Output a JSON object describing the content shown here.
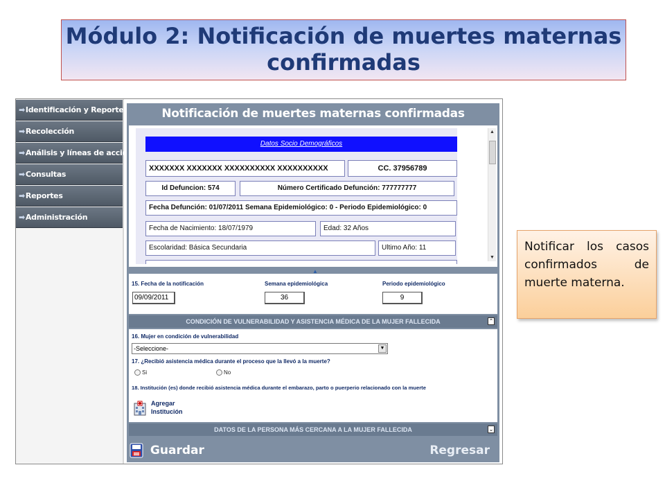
{
  "slide": {
    "title_line1": "Módulo 2: Notificación de muertes maternas",
    "title_line2": "confirmadas"
  },
  "sidebar": {
    "items": [
      {
        "label": "Identificación y Reporte"
      },
      {
        "label": "Recolección"
      },
      {
        "label": "Análisis y líneas de acción"
      },
      {
        "label": "Consultas"
      },
      {
        "label": "Reportes"
      },
      {
        "label": "Administración"
      }
    ]
  },
  "main": {
    "header": "Notificación de muertes maternas confirmadas",
    "socio": {
      "section_title": "Datos Socio Demográficos",
      "name": "XXXXXXX XXXXXXX XXXXXXXXXX XXXXXXXXXX",
      "document": "CC. 37956789",
      "id_defuncion": "Id Defuncion: 574",
      "certificado": "Número Certificado Defunción: 777777777",
      "fecha_defuncion": "Fecha Defunción: 01/07/2011 Semana Epidemiológico: 0 - Periodo Epidemiológico: 0",
      "fecha_nacimiento": "Fecha de Nacimiento: 18/07/1979",
      "edad": "Edad: 32 Años",
      "escolaridad": "Escolaridad: Básica Secundaria",
      "ultimo_anio": "Ultimo Año: 11"
    },
    "notification": {
      "fecha_label": "15. Fecha de la notificación",
      "fecha_value": "09/09/2011",
      "semana_label": "Semana epidemiológica",
      "semana_value": "36",
      "periodo_label": "Periodo epidemiológico",
      "periodo_value": "9"
    },
    "vulnerabilidad": {
      "section_title": "CONDICIÓN DE VULNERABILIDAD Y ASISTENCIA MÉDICA DE LA MUJER FALLECIDA",
      "q16_label": "16. Mujer en condición de vulnerabilidad",
      "q16_selected": "-Seleccione-",
      "q17_label": "17. ¿Recibió asistencia médica durante el proceso que la llevó a la muerte?",
      "opt_si": "Si",
      "opt_no": "No",
      "q18_label": "18. Institución (es) donde recibió asistencia médica durante el embarazo, parto o puerperio relacionado con la muerte",
      "add_line1": "Agregar",
      "add_line2": "Institución"
    },
    "persona_section_title": "DATOS DE LA PERSONA MÁS CERCANA A LA MUJER FALLECIDA",
    "save_label": "Guardar",
    "back_label": "Regresar"
  },
  "note": {
    "text": "Notificar los casos confirmados de muerte materna."
  },
  "colors": {
    "title_text": "#1f3a77",
    "main_bg": "#7f8fa3",
    "blue_bar": "#1010ff",
    "note_fill": "#fbcf9a"
  }
}
